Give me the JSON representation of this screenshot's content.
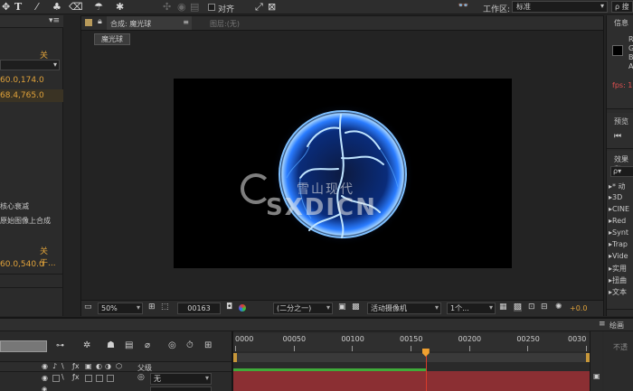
{
  "colors": {
    "accent_orange": "#e0a23a",
    "fps_red": "#e05050",
    "layer_bar_red": "#8b2f33",
    "work_area_green": "#3faa3a",
    "playhead_orange": "#f0a030",
    "playhead_red": "#d83a2a"
  },
  "toolbar": {
    "tool_text": "T",
    "snap_label": "对齐",
    "workspace_label": "工作区:",
    "workspace_value": "标准",
    "search_label": "搜"
  },
  "project": {
    "link_about_1": "关于...",
    "value_1": "60.0,174.0",
    "value_2": "68.4,765.0",
    "item_center_falloff": "核心衰减",
    "item_composite_original": "原始图像上合成",
    "link_about_2": "关于...",
    "value_3": "60.0,540.0"
  },
  "comp": {
    "lock_icon": "lock-icon",
    "tab_label": "合成: 魔光球",
    "tab_menu": "≡",
    "layer_tab": "图层:(无)",
    "breadcrumb": "魔光球",
    "watermark_main": "雪山现代",
    "watermark_sub": "SXDICN",
    "footer": {
      "zoom": "50%",
      "timecode": "00163",
      "resolution": "(二分之一)",
      "camera": "活动摄像机",
      "views": "1个...",
      "exposure": "+0.0"
    }
  },
  "right": {
    "info_title": "信息",
    "info_R": "R",
    "info_G": "G",
    "info_B": "B",
    "info_A": "A",
    "fps_label": "fps: 1",
    "preview_title": "预览",
    "effects_title": "效果和",
    "effects_search": "ρ▾",
    "effects": [
      "* 动",
      "3D",
      "CINE",
      "Red",
      "Synt",
      "Trap",
      "Vide",
      "实用",
      "扭曲",
      "文本"
    ],
    "paint_title": "绘画",
    "paint_note": "不透"
  },
  "timeline": {
    "ruler_labels": [
      "0000",
      "00050",
      "00100",
      "00150",
      "00200",
      "00250",
      "0030"
    ],
    "ruler_values": [
      0,
      50,
      100,
      150,
      200,
      250,
      300
    ],
    "current_frame": 163,
    "parent_label": "父级",
    "parent_value": "无"
  }
}
